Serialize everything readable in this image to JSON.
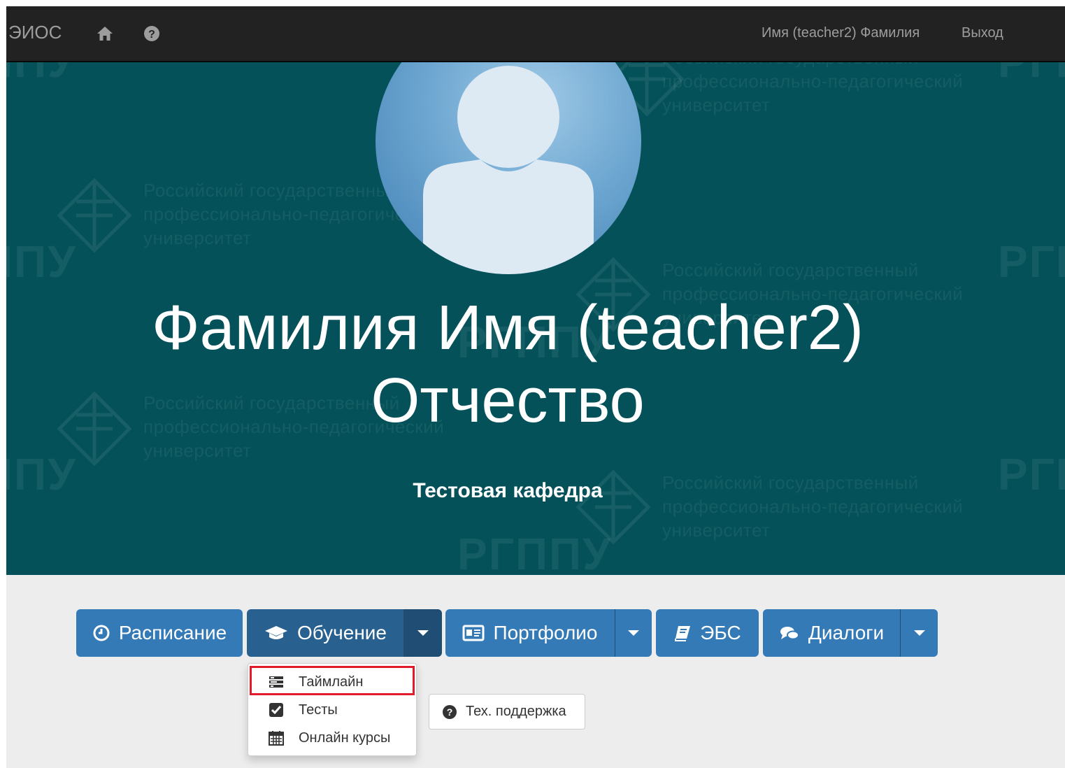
{
  "navbar": {
    "brand": "ЭИОС",
    "home_icon": "home-icon",
    "help_icon": "question-circle-icon",
    "user_name": "Имя (teacher2) Фамилия",
    "logout": "Выход"
  },
  "hero": {
    "name_line1": "Фамилия Имя (teacher2)",
    "name_line2": "Отчество",
    "department": "Тестовая кафедра",
    "watermark": {
      "line1": "Российский государственный",
      "line2": "профессионально-педагогический",
      "line3": "университет",
      "abbr": "РГППУ"
    },
    "background_color": "#045159"
  },
  "buttons": {
    "schedule": {
      "label": "Расписание",
      "icon": "clock-icon"
    },
    "learning": {
      "label": "Обучение",
      "icon": "graduation-cap-icon"
    },
    "portfolio": {
      "label": "Портфолио",
      "icon": "id-card-icon"
    },
    "ebs": {
      "label": "ЭБС",
      "icon": "book-icon"
    },
    "dialogs": {
      "label": "Диалоги",
      "icon": "comments-icon"
    },
    "accent": "#337ab7"
  },
  "dropdown": {
    "items": [
      {
        "label": "Таймлайн",
        "icon": "tasks-icon"
      },
      {
        "label": "Тесты",
        "icon": "check-square-icon"
      },
      {
        "label": "Онлайн курсы",
        "icon": "calendar-icon"
      }
    ]
  },
  "support": {
    "label": "Тех. поддержка",
    "icon": "question-circle-icon"
  }
}
